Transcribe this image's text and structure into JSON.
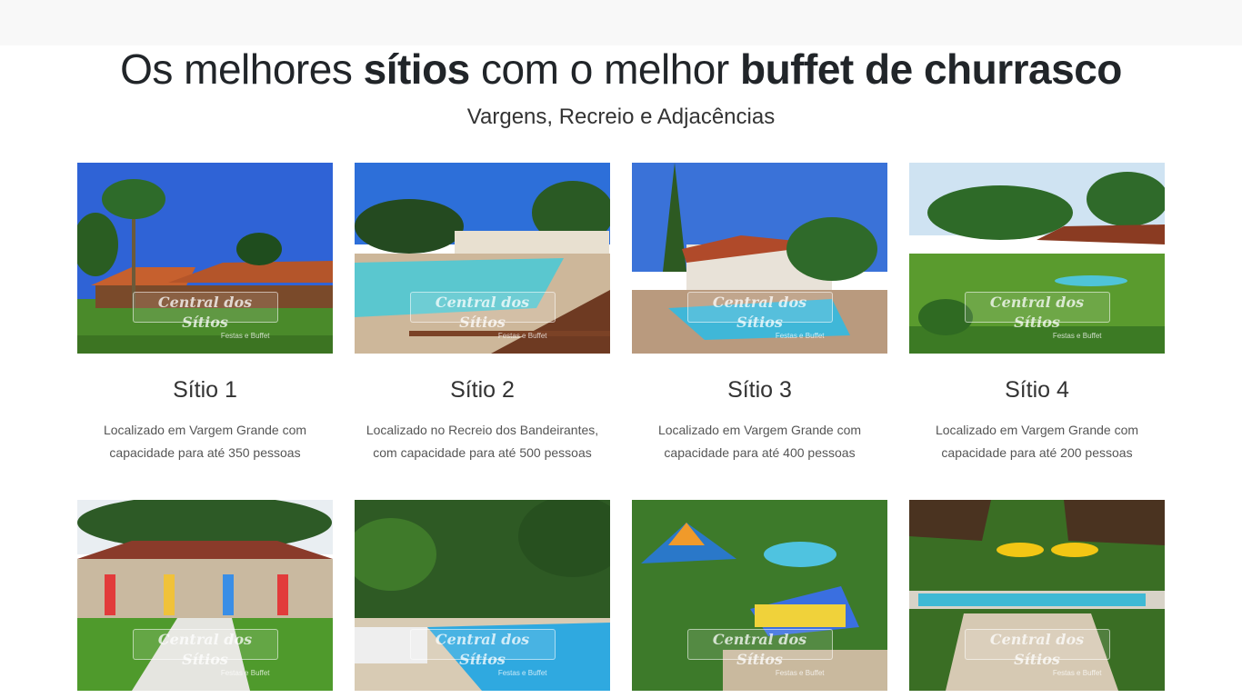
{
  "header": {
    "title_part1": "Os melhores ",
    "title_bold1": "sítios",
    "title_part2": " com o melhor ",
    "title_bold2": "buffet de churrasco",
    "subtitle": "Vargens, Recreio e Adjacências"
  },
  "watermark": {
    "brand": "Central dos Sítios",
    "tagline": "Festas e Buffet"
  },
  "venues": [
    {
      "title": "Sítio 1",
      "desc": "Localizado em Vargem Grande com capacidade para até 350 pessoas"
    },
    {
      "title": "Sítio 2",
      "desc": "Localizado no Recreio dos Bandeirantes, com capacidade para até 500 pessoas"
    },
    {
      "title": "Sítio 3",
      "desc": "Localizado em Vargem Grande com capacidade para até 400 pessoas"
    },
    {
      "title": "Sítio 4",
      "desc": "Localizado em Vargem Grande com capacidade para até 200 pessoas"
    }
  ],
  "colors": {
    "sky": "#3b6fd8",
    "grass": "#4f8a2b",
    "pool": "#58c5d6",
    "roof": "#c25a2c",
    "text": "#212529"
  }
}
